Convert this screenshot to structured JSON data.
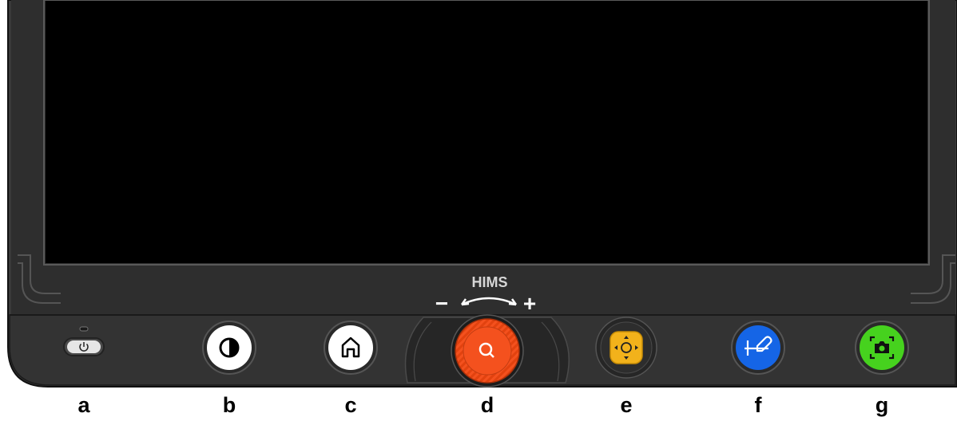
{
  "device": {
    "brand": "HIMS",
    "zoom_minus": "−",
    "zoom_plus": "+"
  },
  "buttons": [
    {
      "key": "power",
      "letter": "a",
      "icon": "power-icon",
      "color": "#e6e6e6"
    },
    {
      "key": "contrast",
      "letter": "b",
      "icon": "contrast-icon",
      "color": "#ffffff"
    },
    {
      "key": "home",
      "letter": "c",
      "icon": "home-icon",
      "color": "#ffffff"
    },
    {
      "key": "zoom",
      "letter": "d",
      "icon": "magnifier-icon",
      "color": "#f4511e"
    },
    {
      "key": "navigation",
      "letter": "e",
      "icon": "directional-pad-icon",
      "color": "#f2b21b"
    },
    {
      "key": "annotate",
      "letter": "f",
      "icon": "pen-icon",
      "color": "#1565e6"
    },
    {
      "key": "capture",
      "letter": "g",
      "icon": "camera-icon",
      "color": "#46d21e"
    }
  ]
}
